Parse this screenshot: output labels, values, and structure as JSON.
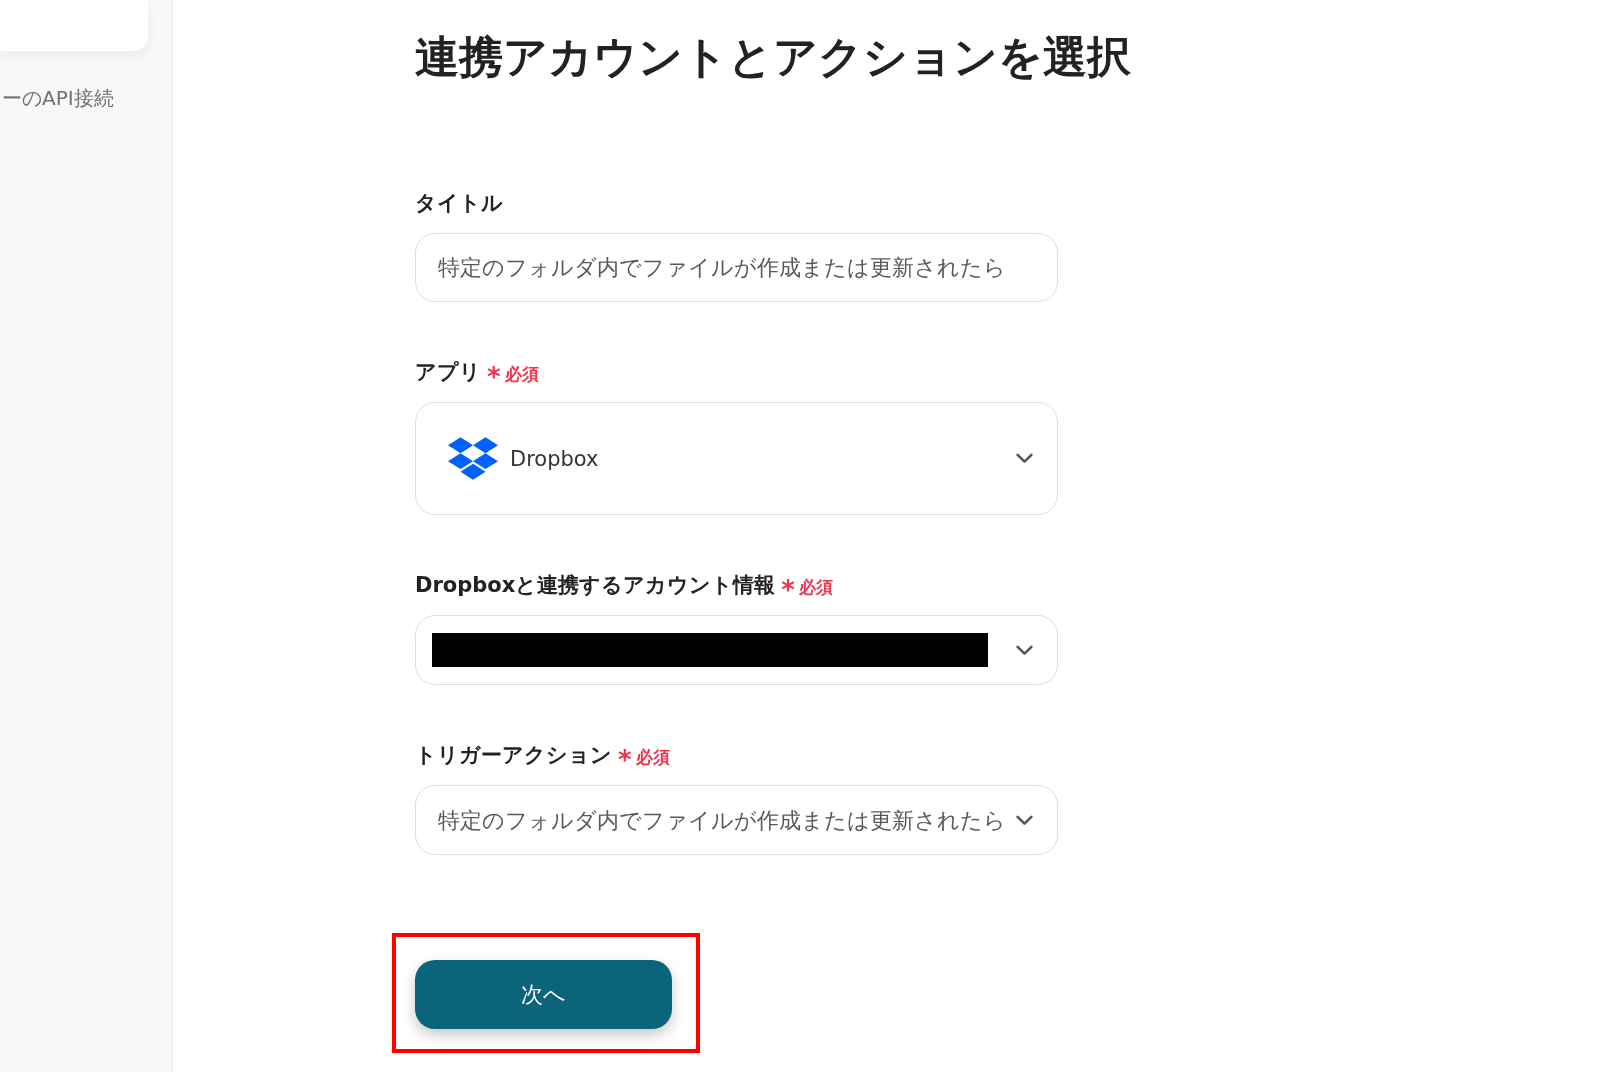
{
  "sidebar": {
    "items": [
      {
        "label": "ーのAPI接続"
      }
    ]
  },
  "page_title": "連携アカウントとアクションを選択",
  "fields": [
    {
      "kind": "text",
      "label": "タイトル",
      "required": false,
      "redacted": false,
      "value": "特定のフォルダ内でファイルが作成または更新されたら"
    },
    {
      "kind": "app_select",
      "label": "アプリ",
      "required": true,
      "required_mark": "*",
      "required_text": "必須",
      "redacted": false,
      "value": "Dropbox"
    },
    {
      "kind": "select",
      "label": "Dropboxと連携するアカウント情報",
      "required": true,
      "required_mark": "*",
      "required_text": "必須",
      "redacted": true
    },
    {
      "kind": "select",
      "label": "トリガーアクション",
      "required": true,
      "required_mark": "*",
      "required_text": "必須",
      "redacted": false,
      "value": "特定のフォルダ内でファイルが作成または更新されたら"
    }
  ],
  "next_button": {
    "label": "次へ",
    "highlighted": true
  }
}
